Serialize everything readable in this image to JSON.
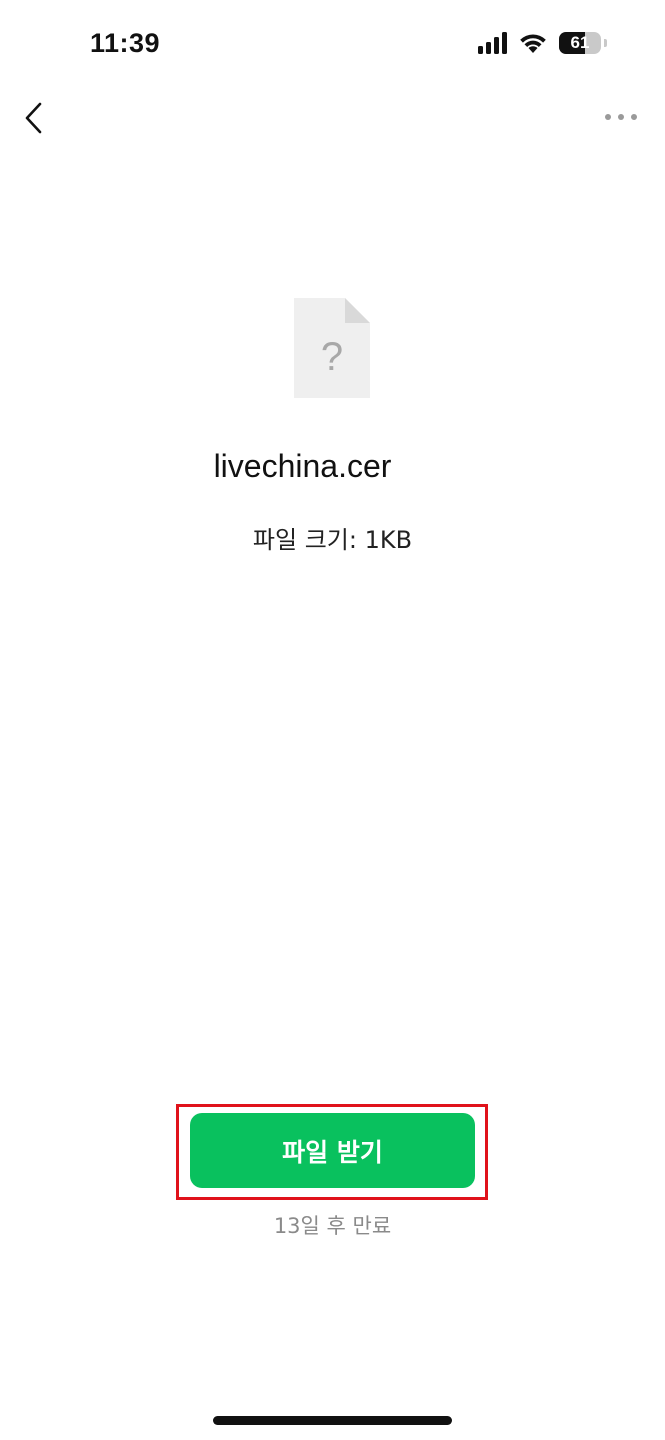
{
  "status_bar": {
    "time": "11:39",
    "battery": "61",
    "battery_level": 0.61
  },
  "nav": {
    "back_icon": "chevron-left-icon",
    "more_icon": "more-horizontal-icon"
  },
  "file": {
    "icon": "unknown-file-icon",
    "icon_glyph": "?",
    "name": "livechina.cer",
    "size_text": "파일 크기: 1KB"
  },
  "actions": {
    "download_label": "파일 받기",
    "expire_text": "13일 후 만료"
  },
  "colors": {
    "accent": "#09c15e",
    "highlight": "#e0121b"
  }
}
